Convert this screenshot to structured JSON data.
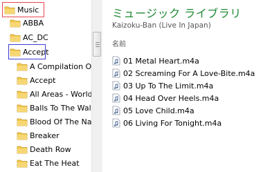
{
  "tree": {
    "root": "Music",
    "items": [
      "ABBA",
      "AC_DC",
      "Accept",
      "A Compilation Of T",
      "Accept",
      "All Areas - Worldw",
      "Balls To The Wall",
      "Blood Of The Natio",
      "Breaker",
      "Death Row",
      "Eat The Heat"
    ]
  },
  "content": {
    "title": "ミュージック ライブラリ",
    "subtitle": "Kaizoku-Ban (Live In Japan)",
    "column_header": "名前",
    "files": [
      "01 Metal Heart.m4a",
      "02 Screaming For A Love-Bite.m4a",
      "03 Up To The Limit.m4a",
      "04 Head Over Heels.m4a",
      "05 Love Child.m4a",
      "06 Living For Tonight.m4a"
    ]
  },
  "colors": {
    "title_green": "#1e8a34",
    "highlight_red": "#e8454f",
    "highlight_blue": "#3b3bd6",
    "folder_yellow": "#f2c94c"
  },
  "icons": {
    "folder": "folder-icon",
    "audio_file": "audio-file-icon"
  }
}
